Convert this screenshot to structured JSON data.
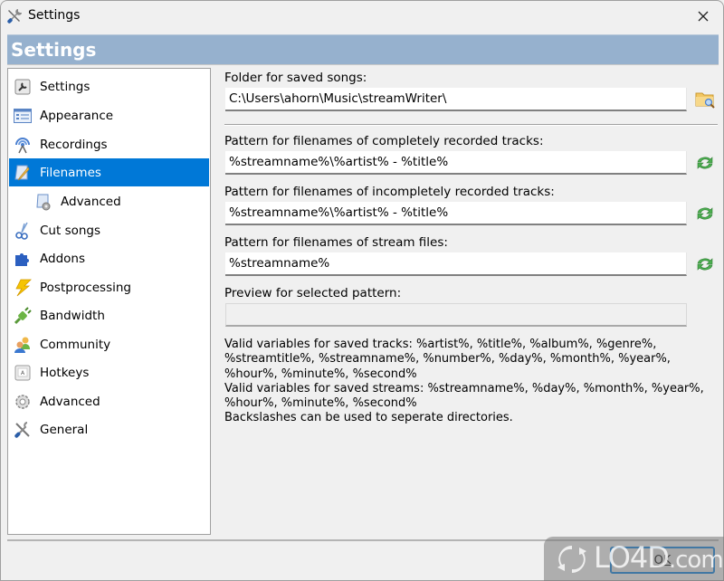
{
  "window": {
    "title": "Settings",
    "close_icon": "close-icon"
  },
  "banner": {
    "title": "Settings"
  },
  "sidebar": {
    "selected": "Filenames",
    "items": [
      {
        "label": "Settings",
        "icon": "settings-wrench-icon",
        "level": 0
      },
      {
        "label": "Appearance",
        "icon": "appearance-form-icon",
        "level": 0
      },
      {
        "label": "Recordings",
        "icon": "broadcast-antenna-icon",
        "level": 0
      },
      {
        "label": "Filenames",
        "icon": "pencil-document-icon",
        "level": 0
      },
      {
        "label": "Advanced",
        "icon": "document-gear-icon",
        "level": 1
      },
      {
        "label": "Cut songs",
        "icon": "scissors-icon",
        "level": 0
      },
      {
        "label": "Addons",
        "icon": "puzzle-icon",
        "level": 0
      },
      {
        "label": "Postprocessing",
        "icon": "lightning-icon",
        "level": 0
      },
      {
        "label": "Bandwidth",
        "icon": "plug-icon",
        "level": 0
      },
      {
        "label": "Community",
        "icon": "users-icon",
        "level": 0
      },
      {
        "label": "Hotkeys",
        "icon": "keyboard-key-icon",
        "level": 0
      },
      {
        "label": "Advanced",
        "icon": "gear-icon",
        "level": 0
      },
      {
        "label": "General",
        "icon": "tools-icon",
        "level": 0
      }
    ]
  },
  "main": {
    "folder": {
      "label": "Folder for saved songs:",
      "value": "C:\\Users\\ahorn\\Music\\streamWriter\\",
      "browse_icon": "folder-search-icon"
    },
    "complete_pattern": {
      "label": "Pattern for filenames of completely recorded tracks:",
      "value": "%streamname%\\%artist% - %title%",
      "reset_icon": "refresh-icon"
    },
    "incomplete_pattern": {
      "label": "Pattern for filenames of incompletely recorded tracks:",
      "value": "%streamname%\\%artist% - %title%",
      "reset_icon": "refresh-icon"
    },
    "stream_pattern": {
      "label": "Pattern for filenames of stream files:",
      "value": "%streamname%",
      "reset_icon": "refresh-icon"
    },
    "preview": {
      "label": "Preview for selected pattern:",
      "value": ""
    },
    "help_lines": [
      "Valid variables for saved tracks: %artist%, %title%, %album%, %genre%,",
      "%streamtitle%, %streamname%, %number%, %day%, %month%, %year%,",
      "%hour%, %minute%, %second%",
      "Valid variables for saved streams: %streamname%, %day%, %month%, %year%,",
      "%hour%, %minute%, %second%",
      "Backslashes can be used to seperate directories."
    ]
  },
  "footer": {
    "ok_label": "OK"
  },
  "watermark": {
    "text": "LO4D",
    "suffix": ".com"
  }
}
